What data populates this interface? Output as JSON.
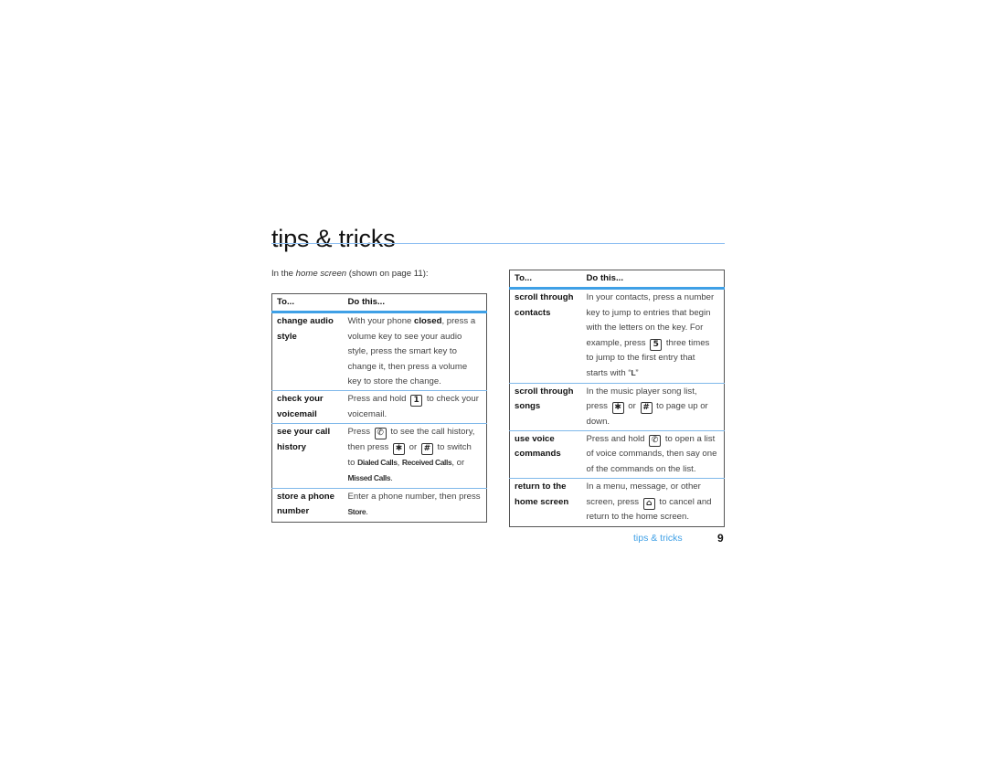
{
  "page": {
    "title": "tips & tricks",
    "intro_prefix": "In the ",
    "intro_italic": "home screen",
    "intro_suffix": " (shown on page 11):",
    "accent_color": "#3fa0e6"
  },
  "left_table": {
    "headers": [
      "To...",
      "Do this..."
    ],
    "rows": [
      {
        "to": "change audio style",
        "do": [
          {
            "t": "With your phone "
          },
          {
            "b": "closed"
          },
          {
            "t": ", press a volume key to see your audio style, press the smart key to change it, then press a volume key to store the change."
          }
        ]
      },
      {
        "to": "check your voicemail",
        "do": [
          {
            "t": "Press and hold "
          },
          {
            "key": "1",
            "icon": "key-1-icon"
          },
          {
            "t": " to check your voicemail."
          }
        ]
      },
      {
        "to": "see your call history",
        "do": [
          {
            "t": "Press "
          },
          {
            "key": "✆",
            "icon": "send-key-icon"
          },
          {
            "t": " to see the call history, then press "
          },
          {
            "key": "✱",
            "icon": "star-key-icon"
          },
          {
            "t": " or "
          },
          {
            "key": "#",
            "icon": "pound-key-icon"
          },
          {
            "t": " to switch to "
          },
          {
            "d": "Dialed Calls"
          },
          {
            "t": ", "
          },
          {
            "d": "Received Calls"
          },
          {
            "t": ", or "
          },
          {
            "d": "Missed Calls"
          },
          {
            "t": "."
          }
        ]
      },
      {
        "to": "store a phone number",
        "do": [
          {
            "t": "Enter a phone number, then press "
          },
          {
            "d": "Store"
          },
          {
            "t": "."
          }
        ]
      }
    ]
  },
  "right_table": {
    "headers": [
      "To...",
      "Do this..."
    ],
    "rows": [
      {
        "to": "scroll through contacts",
        "do": [
          {
            "t": "In your contacts, press a number key to jump to entries that begin with the letters on the key. For example, press "
          },
          {
            "key": "5",
            "icon": "key-5-icon"
          },
          {
            "t": " three times to jump to the first entry that starts with “"
          },
          {
            "d": "L"
          },
          {
            "t": "”"
          }
        ]
      },
      {
        "to": "scroll through songs",
        "do": [
          {
            "t": "In the music player song list, press "
          },
          {
            "key": "✱",
            "icon": "star-key-icon"
          },
          {
            "t": " or "
          },
          {
            "key": "#",
            "icon": "pound-key-icon"
          },
          {
            "t": " to page up or down."
          }
        ]
      },
      {
        "to": "use voice commands",
        "do": [
          {
            "t": "Press and hold "
          },
          {
            "key": "✆",
            "icon": "send-key-icon"
          },
          {
            "t": " to open a list of voice commands, then say one of the commands on the list."
          }
        ]
      },
      {
        "to": "return to the home screen",
        "do": [
          {
            "t": "In a menu, message, or other screen, press "
          },
          {
            "key": "⌂",
            "icon": "end-key-icon"
          },
          {
            "t": " to cancel and return to the home screen."
          }
        ]
      }
    ]
  },
  "footer": {
    "section": "tips & tricks",
    "page_number": "9"
  }
}
